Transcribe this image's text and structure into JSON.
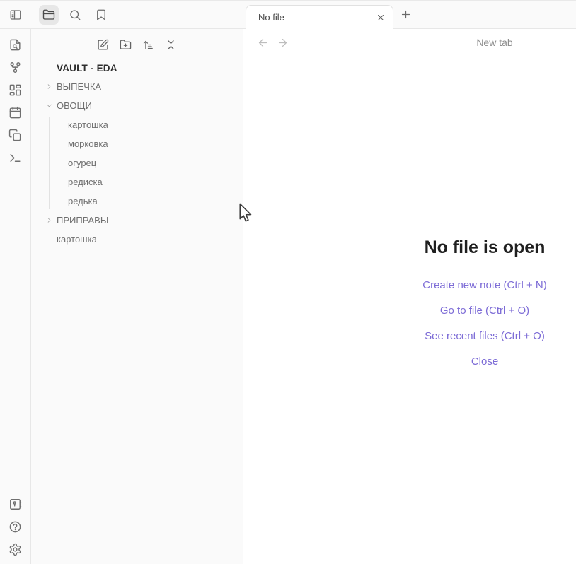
{
  "colors": {
    "accent": "#7c6bd6"
  },
  "top_strip": {
    "icons": [
      "panel-left",
      "folder",
      "search",
      "bookmark"
    ],
    "active_icon": "folder"
  },
  "ribbon": {
    "icons": [
      "file-search",
      "graph",
      "layout-dashboard",
      "calendar",
      "copy",
      "terminal"
    ],
    "bottom_icons": [
      "vault",
      "help",
      "settings"
    ]
  },
  "explorer": {
    "actions": [
      "new-note",
      "new-folder",
      "sort-order",
      "collapse-all"
    ],
    "vault_title": "VAULT - EDA",
    "tree": [
      {
        "type": "folder",
        "label": "ВЫПЕЧКА",
        "state": "collapsed"
      },
      {
        "type": "folder",
        "label": "ОВОЩИ",
        "state": "expanded"
      },
      {
        "type": "file",
        "label": "картошка",
        "nested": true
      },
      {
        "type": "file",
        "label": "морковка",
        "nested": true
      },
      {
        "type": "file",
        "label": "огурец",
        "nested": true
      },
      {
        "type": "file",
        "label": "редиска",
        "nested": true
      },
      {
        "type": "file",
        "label": "редька",
        "nested": true
      },
      {
        "type": "folder",
        "label": "ПРИПРАВЫ",
        "state": "collapsed"
      },
      {
        "type": "file",
        "label": "картошка",
        "nested": false
      }
    ]
  },
  "main": {
    "tab_title": "No file",
    "view_title": "New tab",
    "empty": {
      "heading": "No file is open",
      "links": [
        "Create new note (Ctrl + N)",
        "Go to file (Ctrl + O)",
        "See recent files (Ctrl + O)",
        "Close"
      ]
    }
  }
}
